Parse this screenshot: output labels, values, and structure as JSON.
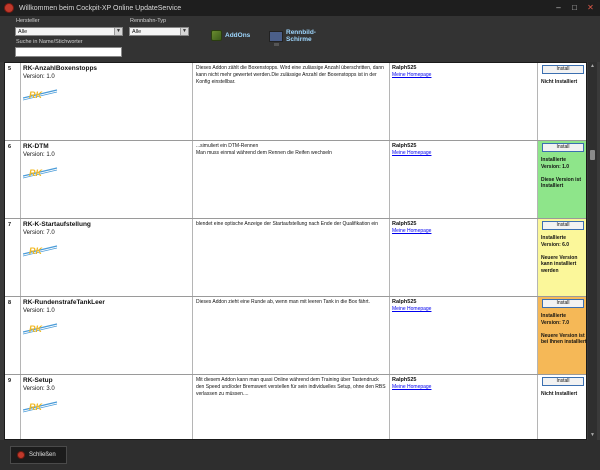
{
  "window": {
    "title": "Willkommen beim Cockpit-XP Online UpdateService",
    "minimize_glyph": "–",
    "maximize_glyph": "□",
    "close_glyph": "✕"
  },
  "filters": {
    "hersteller_label": "Hersteller",
    "hersteller_value": "Alle",
    "rennbahn_label": "Rennbahn-Typ",
    "rennbahn_value": "Alle",
    "search_label": "Suche in Name/Stichworter",
    "search_value": ""
  },
  "toolbar": {
    "addons_label": "AddOns",
    "rennbild_label_1": "Rennbild-",
    "rennbild_label_2": "Schirme"
  },
  "addons": [
    {
      "num": "5",
      "name": "RK-AnzahlBoxenstopps",
      "version": "Version: 1.0",
      "logo": "RK",
      "description": "Dieses Addon zählt die Boxenstopps. Wird eine zulässige Anzahl überschritten, dann kann nicht mehr gewertet werden.Die zulässige Anzahl der Boxenstopps ist in der Konfig einstellbar.",
      "author": "Ralph525",
      "homepage": "Meine Homepage",
      "install_label": "Install",
      "status": "Nicht Installiert",
      "status_color": "#ffffff"
    },
    {
      "num": "6",
      "name": "RK-DTM",
      "version": "Version: 1.0",
      "logo": "RK",
      "description": "...simuliert ein DTM-Rennen\nMan muss einmal während dem Rennen die Reifen wechseln",
      "author": "Ralph525",
      "homepage": "Meine Homepage",
      "install_label": "Install",
      "status": "Installierte Version: 1.0\n\nDiese Version ist Installiert",
      "status_color": "#8ee58a"
    },
    {
      "num": "7",
      "name": "RK-K-Startaufstellung",
      "version": "Version: 7.0",
      "logo": "RK",
      "description": "blendet eine optische Anzeige der Startaufstellung nach Ende der Qualifikation ein",
      "author": "Ralph525",
      "homepage": "Meine Homepage",
      "install_label": "Install",
      "status": "Installierte Version: 6.0\n\nNeuere Version kann installiert werden",
      "status_color": "#fbf79a"
    },
    {
      "num": "8",
      "name": "RK-RundenstrafeTankLeer",
      "version": "Version: 1.0",
      "logo": "RK",
      "description": "Dieses Addon zieht eine Runde ab, wenn man mit leeren Tank in die Box fährt.",
      "author": "Ralph525",
      "homepage": "Meine Homepage",
      "install_label": "Install",
      "status": "Installierte Version: 7.0\n\nNeuere Version ist bei Ihnen installiert",
      "status_color": "#f5b857"
    },
    {
      "num": "9",
      "name": "RK-Setup",
      "version": "Version: 3.0",
      "logo": "RK",
      "description": "Mit diesem Addon kann man quasi Online während dem Training über Tastendruck den Speed und/oder Bremswert verstellen für sein individuelles Setup, ohne den RBS verlassen zu müssen....",
      "author": "Ralph525",
      "homepage": "Meine Homepage",
      "install_label": "Install",
      "status": "Nicht Installiert",
      "status_color": "#ffffff"
    }
  ],
  "footer": {
    "close_label": "Schließen"
  }
}
